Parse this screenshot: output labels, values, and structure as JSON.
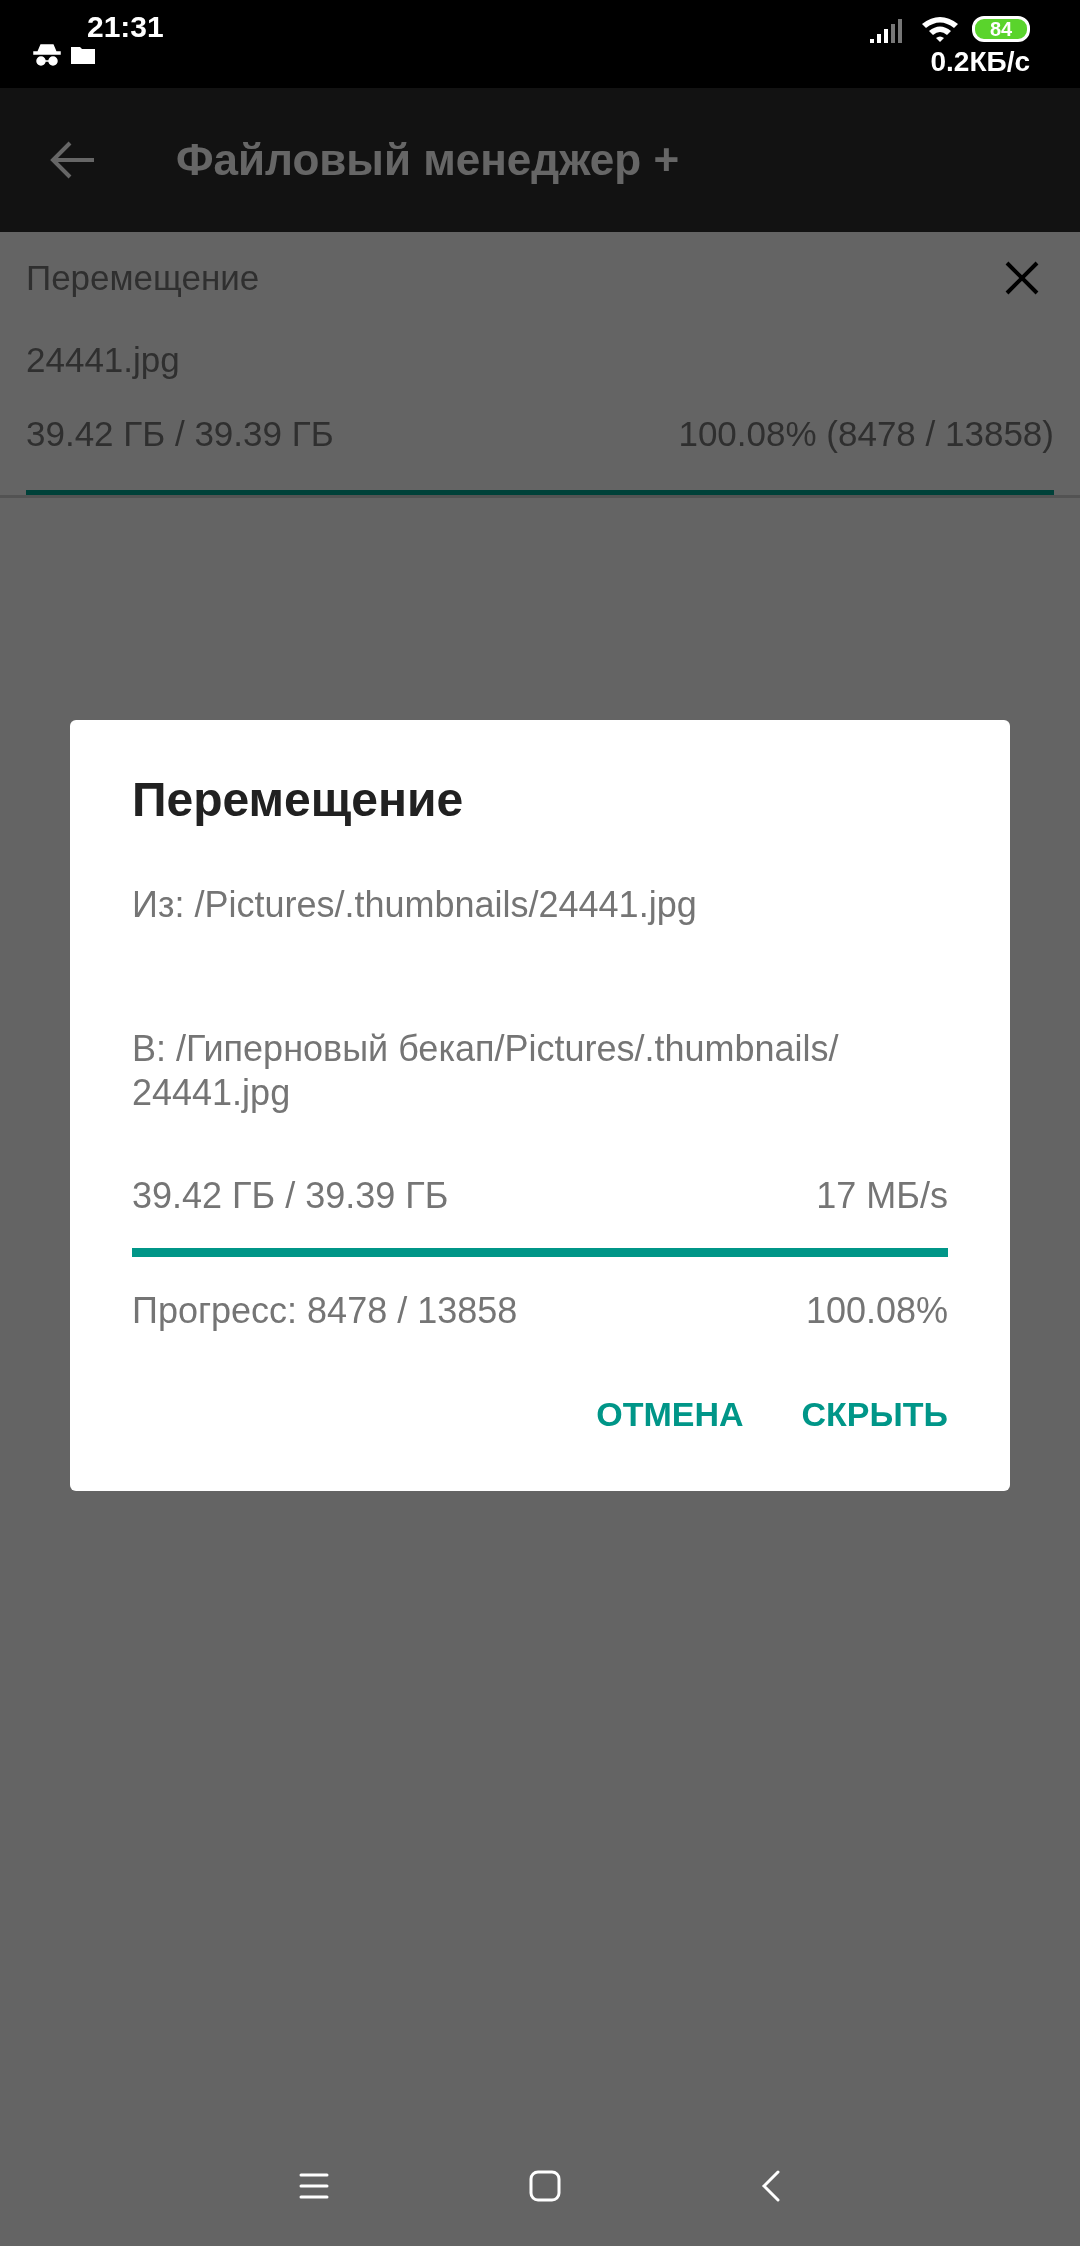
{
  "status_bar": {
    "time": "21:31",
    "battery": "84",
    "net_speed": "0.2КБ/с"
  },
  "app_bar": {
    "title": "Файловый менеджер +"
  },
  "notification": {
    "title": "Перемещение",
    "file": "24441.jpg",
    "size": "39.42 ГБ / 39.39 ГБ",
    "progress": "100.08% (8478 / 13858)",
    "level": 1
  },
  "dialog": {
    "title": "Перемещение",
    "from": "Из: /Pictures/.thumbnails/24441.jpg",
    "to": "В: /Гиперновый бекап/Pictures/.thumbnails/ 24441.jpg",
    "size": "39.42 ГБ / 39.39 ГБ",
    "speed": "17 МБ/s",
    "level": 1,
    "progress": "Прогресс: 8478 / 13858",
    "percent": "100.08%",
    "buttons": [
      {
        "label": "ОТМЕНА"
      },
      {
        "label": "СКРЫТЬ"
      }
    ]
  }
}
